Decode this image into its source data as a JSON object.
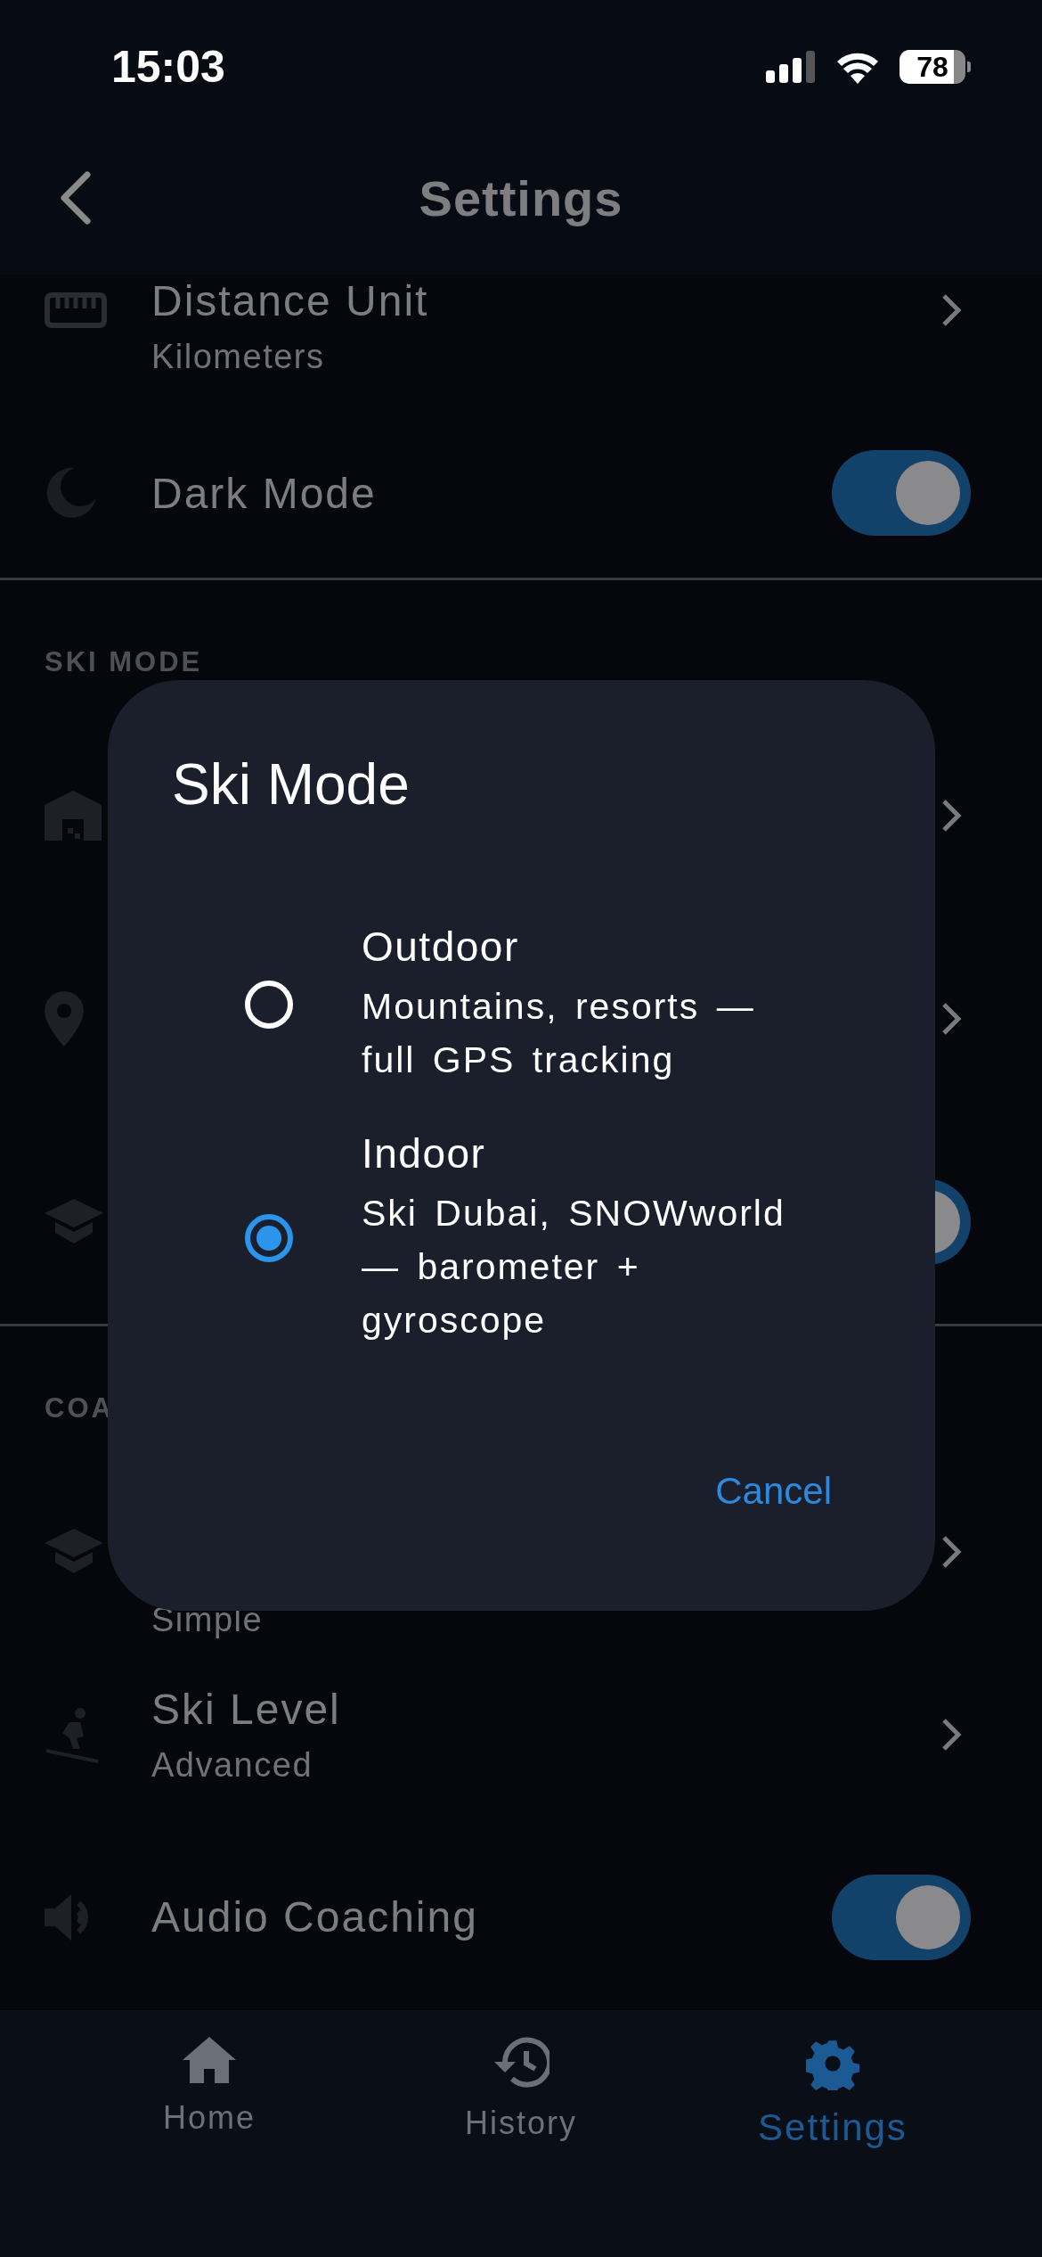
{
  "status_bar": {
    "time": "15:03",
    "battery": "78"
  },
  "nav_bar": {
    "title": "Settings"
  },
  "sections": [
    {
      "rows": [
        {
          "kind": "nav",
          "title": "Distance Unit",
          "subtitle": "Kilometers"
        },
        {
          "kind": "toggle",
          "title": "Dark Mode",
          "on": true
        }
      ]
    },
    {
      "header": "SKI MODE",
      "rows": [
        {
          "kind": "nav"
        },
        {
          "kind": "nav"
        },
        {
          "kind": "toggle",
          "on": true
        }
      ]
    },
    {
      "header": "COA",
      "rows": [
        {
          "kind": "nav",
          "subtitle": "Simple"
        },
        {
          "kind": "nav",
          "title": "Ski Level",
          "subtitle": "Advanced"
        },
        {
          "kind": "toggle",
          "title": "Audio Coaching",
          "on": true
        }
      ]
    }
  ],
  "dialog": {
    "title": "Ski Mode",
    "options": [
      {
        "title": "Outdoor",
        "description": "Mountains, resorts — full GPS tracking",
        "selected": false
      },
      {
        "title": "Indoor",
        "description": "Ski Dubai, SNOWworld — barometer + gyroscope",
        "selected": true
      }
    ],
    "cancel": "Cancel"
  },
  "tab_bar": [
    {
      "label": "Home",
      "selected": false
    },
    {
      "label": "History",
      "selected": false
    },
    {
      "label": "Settings",
      "selected": true
    }
  ]
}
